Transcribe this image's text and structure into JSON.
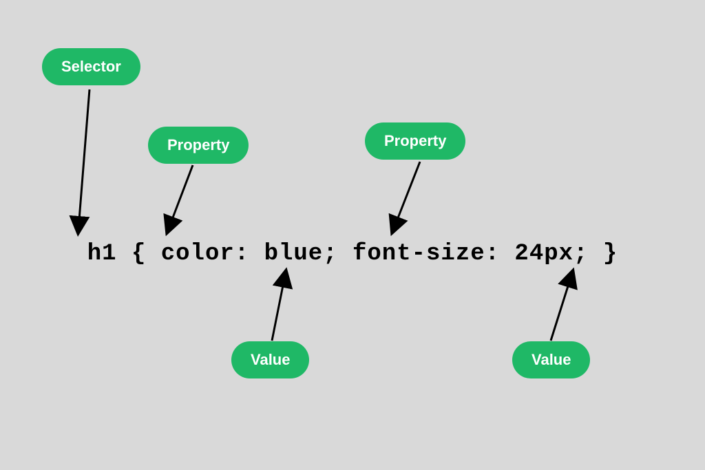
{
  "labels": {
    "selector": "Selector",
    "property1": "Property",
    "property2": "Property",
    "value1": "Value",
    "value2": "Value"
  },
  "code": "h1 { color: blue; font-size: 24px; }",
  "colors": {
    "labelBg": "#1fb866",
    "labelText": "#ffffff",
    "bodyBg": "#d9d9d9"
  }
}
